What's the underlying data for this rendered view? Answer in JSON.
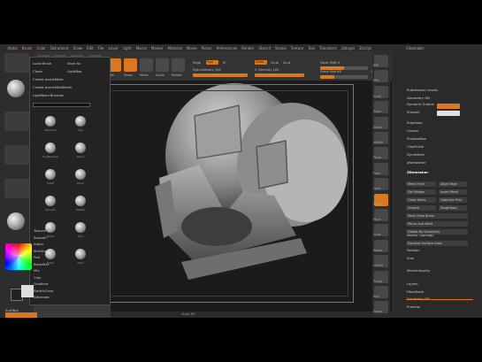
{
  "menubar": {
    "items": [
      "Alpha",
      "Brush",
      "Color",
      "Document",
      "Draw",
      "Edit",
      "File",
      "Layer",
      "Light",
      "Macro",
      "Marker",
      "Material",
      "Movie",
      "Picker",
      "Preferences",
      "Render",
      "Stencil",
      "Stroke",
      "Texture",
      "Tool",
      "Transform",
      "Zplugin",
      "Zscript"
    ],
    "active_index": 1
  },
  "right_header": {
    "label": "Clearcolor"
  },
  "shelf": {
    "edit": "Edit",
    "draw": "Draw",
    "move": "Move",
    "scale": "Scale",
    "rotate": "Rotate",
    "mrgb": "Mrgb",
    "rgb": "Rgb",
    "m": "M",
    "zadd": "Zadd",
    "zsub": "Zsub",
    "zcut": "Zcut",
    "rgb_intensity": "Rgb Intensity 100",
    "z_intensity": "Z Intensity 100",
    "focal_shift": "Focal Shift 0",
    "draw_size": "Draw Size 64",
    "dynamic": "Dynamic"
  },
  "brush_popup": {
    "rows": [
      [
        "Load Brush",
        "Save As"
      ],
      [
        "Clone",
        "LightBox"
      ],
      [
        "Create InsertMesh",
        ""
      ],
      [
        "Create InsertMultiMesh",
        ""
      ],
      [
        "LightBox>Brushes",
        ""
      ]
    ],
    "search_hint": "Brush",
    "cells": [
      "Standard",
      "Clay",
      "ClayBuildup",
      "Move",
      "Inflat",
      "Pinch",
      "Smooth",
      "Flatten",
      "Polish",
      "Trim",
      "Slash",
      "Dam"
    ]
  },
  "materials": {
    "items": [
      "Texture",
      "Smooth",
      "Alpha",
      "SkinShade",
      "Flat",
      "BasicMat",
      "Mix",
      "Clay",
      "Gradient",
      "SwitchColor",
      "Alternate"
    ]
  },
  "right_icons": {
    "items": [
      "BPR",
      "SPix",
      "Scroll",
      "Zoom",
      "Actual",
      "AAHalf",
      "Persp",
      "Floor",
      "Local",
      "Frame",
      "Move",
      "Scale",
      "Rotate",
      "LineFill",
      "Transp",
      "Solo",
      "Xpose"
    ],
    "orange": [
      9
    ]
  },
  "right_palette": {
    "lines": [
      {
        "text": "Subdivision Levels",
        "hl": false
      },
      {
        "text": "Geometry HD",
        "hl": false
      },
      {
        "text": "Dynamic Subdiv",
        "hl": false
      },
      {
        "text": "Smooth",
        "hl": false
      },
      {
        "text": "Edgeloop",
        "hl": false
      },
      {
        "text": "Crease",
        "hl": false
      },
      {
        "text": "ShadowBox",
        "hl": false
      },
      {
        "text": "ClayPolish",
        "hl": false
      },
      {
        "text": "DynaMesh",
        "hl": false
      },
      {
        "text": "qRemesher",
        "hl": false
      },
      {
        "text": "ZRemesher",
        "hl": true
      },
      {
        "text": "Modify Topology",
        "hl": false
      },
      {
        "text": "Position",
        "hl": false
      },
      {
        "text": "Size",
        "hl": false
      },
      {
        "text": "MeshIntegrity",
        "hl": false
      }
    ],
    "buttons": [
      "Mesh From",
      "Align Edge",
      "Del Hidden",
      "Insert Mesh",
      "Close Holes",
      "Optimize Pnts",
      "Unweld",
      "StageTools",
      "Mesh From Brush",
      "Mirror And Weld",
      "Delete By Symmetry",
      "Equalize Surface Area"
    ],
    "lower": [
      "Layers",
      "FiberMesh",
      "Geometry HD",
      "Preview"
    ]
  },
  "canvas": {
    "bottom_label": "Store MT"
  },
  "status": {
    "left": "SubTool"
  }
}
